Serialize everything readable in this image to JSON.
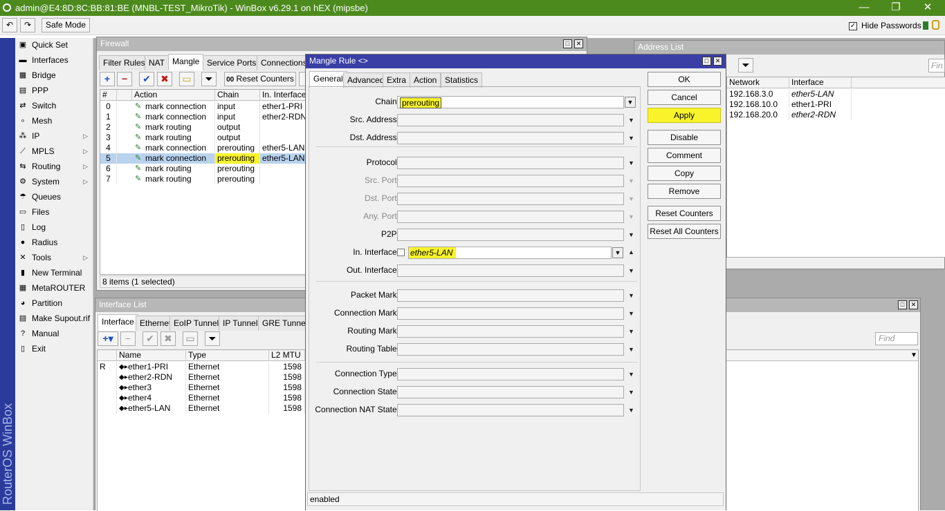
{
  "title_bar": {
    "text": "admin@E4:8D:8C:BB:81:BE (MNBL-TEST_MikroTik) - WinBox v6.29.1 on hEX (mipsbe)",
    "min": "—",
    "restore": "❐",
    "close": "✕"
  },
  "toolbar": {
    "undo": "↶",
    "redo": "↷",
    "safe_mode": "Safe Mode",
    "hide_passwords": "Hide Passwords",
    "hide_passwords_checked": "✓"
  },
  "side_brand": "RouterOS WinBox",
  "menu": [
    {
      "label": "Quick Set",
      "icon": "quick-set-icon",
      "glyph": "▣",
      "arrow": ""
    },
    {
      "label": "Interfaces",
      "icon": "interfaces-icon",
      "glyph": "▬",
      "arrow": ""
    },
    {
      "label": "Bridge",
      "icon": "bridge-icon",
      "glyph": "▦",
      "arrow": ""
    },
    {
      "label": "PPP",
      "icon": "ppp-icon",
      "glyph": "▤",
      "arrow": ""
    },
    {
      "label": "Switch",
      "icon": "switch-icon",
      "glyph": "⇄",
      "arrow": ""
    },
    {
      "label": "Mesh",
      "icon": "mesh-icon",
      "glyph": "∘",
      "arrow": ""
    },
    {
      "label": "IP",
      "icon": "ip-icon",
      "glyph": "⁂",
      "arrow": "▷"
    },
    {
      "label": "MPLS",
      "icon": "mpls-icon",
      "glyph": "⟋",
      "arrow": "▷"
    },
    {
      "label": "Routing",
      "icon": "routing-icon",
      "glyph": "⇆",
      "arrow": "▷"
    },
    {
      "label": "System",
      "icon": "system-icon",
      "glyph": "⚙",
      "arrow": "▷"
    },
    {
      "label": "Queues",
      "icon": "queues-icon",
      "glyph": "☂",
      "arrow": ""
    },
    {
      "label": "Files",
      "icon": "files-icon",
      "glyph": "▭",
      "arrow": ""
    },
    {
      "label": "Log",
      "icon": "log-icon",
      "glyph": "▯",
      "arrow": ""
    },
    {
      "label": "Radius",
      "icon": "radius-icon",
      "glyph": "●",
      "arrow": ""
    },
    {
      "label": "Tools",
      "icon": "tools-icon",
      "glyph": "✕",
      "arrow": "▷"
    },
    {
      "label": "New Terminal",
      "icon": "terminal-icon",
      "glyph": "▮",
      "arrow": ""
    },
    {
      "label": "MetaROUTER",
      "icon": "metarouter-icon",
      "glyph": "▦",
      "arrow": ""
    },
    {
      "label": "Partition",
      "icon": "partition-icon",
      "glyph": "◕",
      "arrow": ""
    },
    {
      "label": "Make Supout.rif",
      "icon": "supout-icon",
      "glyph": "▤",
      "arrow": ""
    },
    {
      "label": "Manual",
      "icon": "manual-icon",
      "glyph": "?",
      "arrow": ""
    },
    {
      "label": "Exit",
      "icon": "exit-icon",
      "glyph": "▯",
      "arrow": ""
    }
  ],
  "firewall": {
    "title": "Firewall",
    "tabs": [
      "Filter Rules",
      "NAT",
      "Mangle",
      "Service Ports",
      "Connections"
    ],
    "reset_counters": "Reset Counters",
    "reset_prefix": "00",
    "columns": [
      "#",
      "Action",
      "Chain",
      "In. Interface"
    ],
    "rows": [
      {
        "num": "0",
        "action": "mark connection",
        "chain": "input",
        "iface": "ether1-PRI"
      },
      {
        "num": "1",
        "action": "mark connection",
        "chain": "input",
        "iface": "ether2-RDN"
      },
      {
        "num": "2",
        "action": "mark routing",
        "chain": "output",
        "iface": ""
      },
      {
        "num": "3",
        "action": "mark routing",
        "chain": "output",
        "iface": ""
      },
      {
        "num": "4",
        "action": "mark connection",
        "chain": "prerouting",
        "iface": "ether5-LAN"
      },
      {
        "num": "5",
        "action": "mark connection",
        "chain": "prerouting",
        "iface": "ether5-LAN"
      },
      {
        "num": "6",
        "action": "mark routing",
        "chain": "prerouting",
        "iface": ""
      },
      {
        "num": "7",
        "action": "mark routing",
        "chain": "prerouting",
        "iface": ""
      }
    ],
    "status": "8 items (1 selected)"
  },
  "interface_list": {
    "title": "Interface List",
    "tabs": [
      "Interface",
      "Ethernet",
      "EoIP Tunnel",
      "IP Tunnel",
      "GRE Tunnel"
    ],
    "columns": [
      "Name",
      "Type",
      "L2 MTU"
    ],
    "rows": [
      {
        "flag": "R",
        "name": "ether1-PRI",
        "type": "Ethernet",
        "mtu": "1598"
      },
      {
        "flag": "",
        "name": "ether2-RDN",
        "type": "Ethernet",
        "mtu": "1598"
      },
      {
        "flag": "",
        "name": "ether3",
        "type": "Ethernet",
        "mtu": "1598"
      },
      {
        "flag": "",
        "name": "ether4",
        "type": "Ethernet",
        "mtu": "1598"
      },
      {
        "flag": "",
        "name": "ether5-LAN",
        "type": "Ethernet",
        "mtu": "1598"
      }
    ],
    "find_placeholder": "Find"
  },
  "address_list": {
    "title": "Address List",
    "find_placeholder": "Fin",
    "columns": [
      "Network",
      "Interface"
    ],
    "rows": [
      {
        "network": "192.168.3.0",
        "iface": "ether5-LAN"
      },
      {
        "network": "192.168.10.0",
        "iface": "ether1-PRI"
      },
      {
        "network": "192.168.20.0",
        "iface": "ether2-RDN"
      }
    ]
  },
  "mangle_rule": {
    "title": "Mangle Rule <>",
    "tabs": [
      "General",
      "Advanced",
      "Extra",
      "Action",
      "Statistics"
    ],
    "labels": {
      "chain": "Chain:",
      "src_address": "Src. Address:",
      "dst_address": "Dst. Address:",
      "protocol": "Protocol:",
      "src_port": "Src. Port:",
      "dst_port": "Dst. Port:",
      "any_port": "Any. Port:",
      "p2p": "P2P:",
      "in_interface": "In. Interface:",
      "out_interface": "Out. Interface:",
      "packet_mark": "Packet Mark:",
      "connection_mark": "Connection Mark:",
      "routing_mark": "Routing Mark:",
      "routing_table": "Routing Table:",
      "connection_type": "Connection Type:",
      "connection_state": "Connection State:",
      "connection_nat_state": "Connection NAT State:"
    },
    "values": {
      "chain": "prerouting",
      "in_interface": "ether5-LAN"
    },
    "buttons": {
      "ok": "OK",
      "cancel": "Cancel",
      "apply": "Apply",
      "disable": "Disable",
      "comment": "Comment",
      "copy": "Copy",
      "remove": "Remove",
      "reset_counters": "Reset Counters",
      "reset_all_counters": "Reset All Counters"
    },
    "status": "enabled"
  },
  "colors": {
    "title_green": "#4c8a1d",
    "active_title": "#3a3fa6",
    "highlight": "#f8f32b",
    "selected_row": "#b9d3ef"
  }
}
